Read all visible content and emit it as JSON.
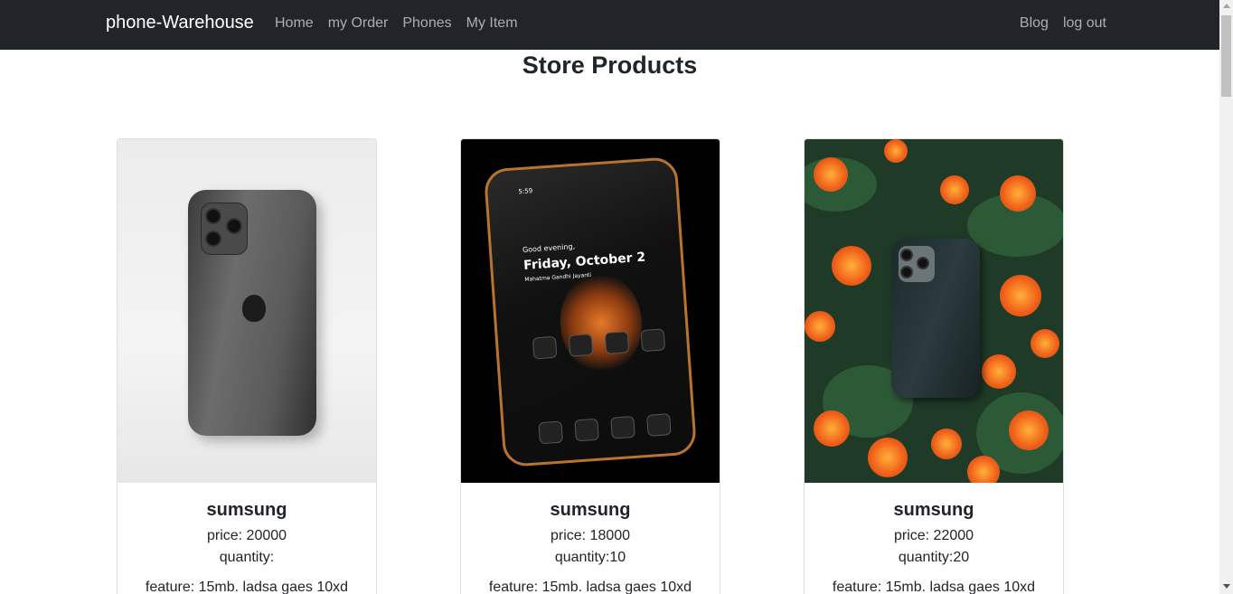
{
  "navbar": {
    "brand": "phone-Warehouse",
    "left_links": [
      "Home",
      "my Order",
      "Phones",
      "My Item"
    ],
    "right_links": [
      "Blog",
      "log out"
    ]
  },
  "page": {
    "title": "Store Products"
  },
  "products": [
    {
      "name": "sumsung",
      "price": "price: 20000",
      "quantity": "quantity:",
      "feature": "feature: 15mb. ladsa gaes 10xd",
      "image": "gray-iphone-photo"
    },
    {
      "name": "sumsung",
      "price": "price: 18000",
      "quantity": "quantity:10",
      "feature": "feature: 15mb. ladsa gaes 10xd",
      "image": "dark-phone-photo",
      "screen": {
        "greeting": "Good evening,",
        "date": "Friday, October 2",
        "sub": "Mahatma Gandhi Jayanti",
        "time": "5:59"
      }
    },
    {
      "name": "sumsung",
      "price": "price: 22000",
      "quantity": "quantity:20",
      "feature": "feature: 15mb. ladsa gaes 10xd",
      "image": "phone-on-flowers-photo"
    }
  ],
  "colors": {
    "navbar_bg": "#212529",
    "nav_link": "rgba(255,255,255,0.62)",
    "brand": "#ffffff"
  }
}
